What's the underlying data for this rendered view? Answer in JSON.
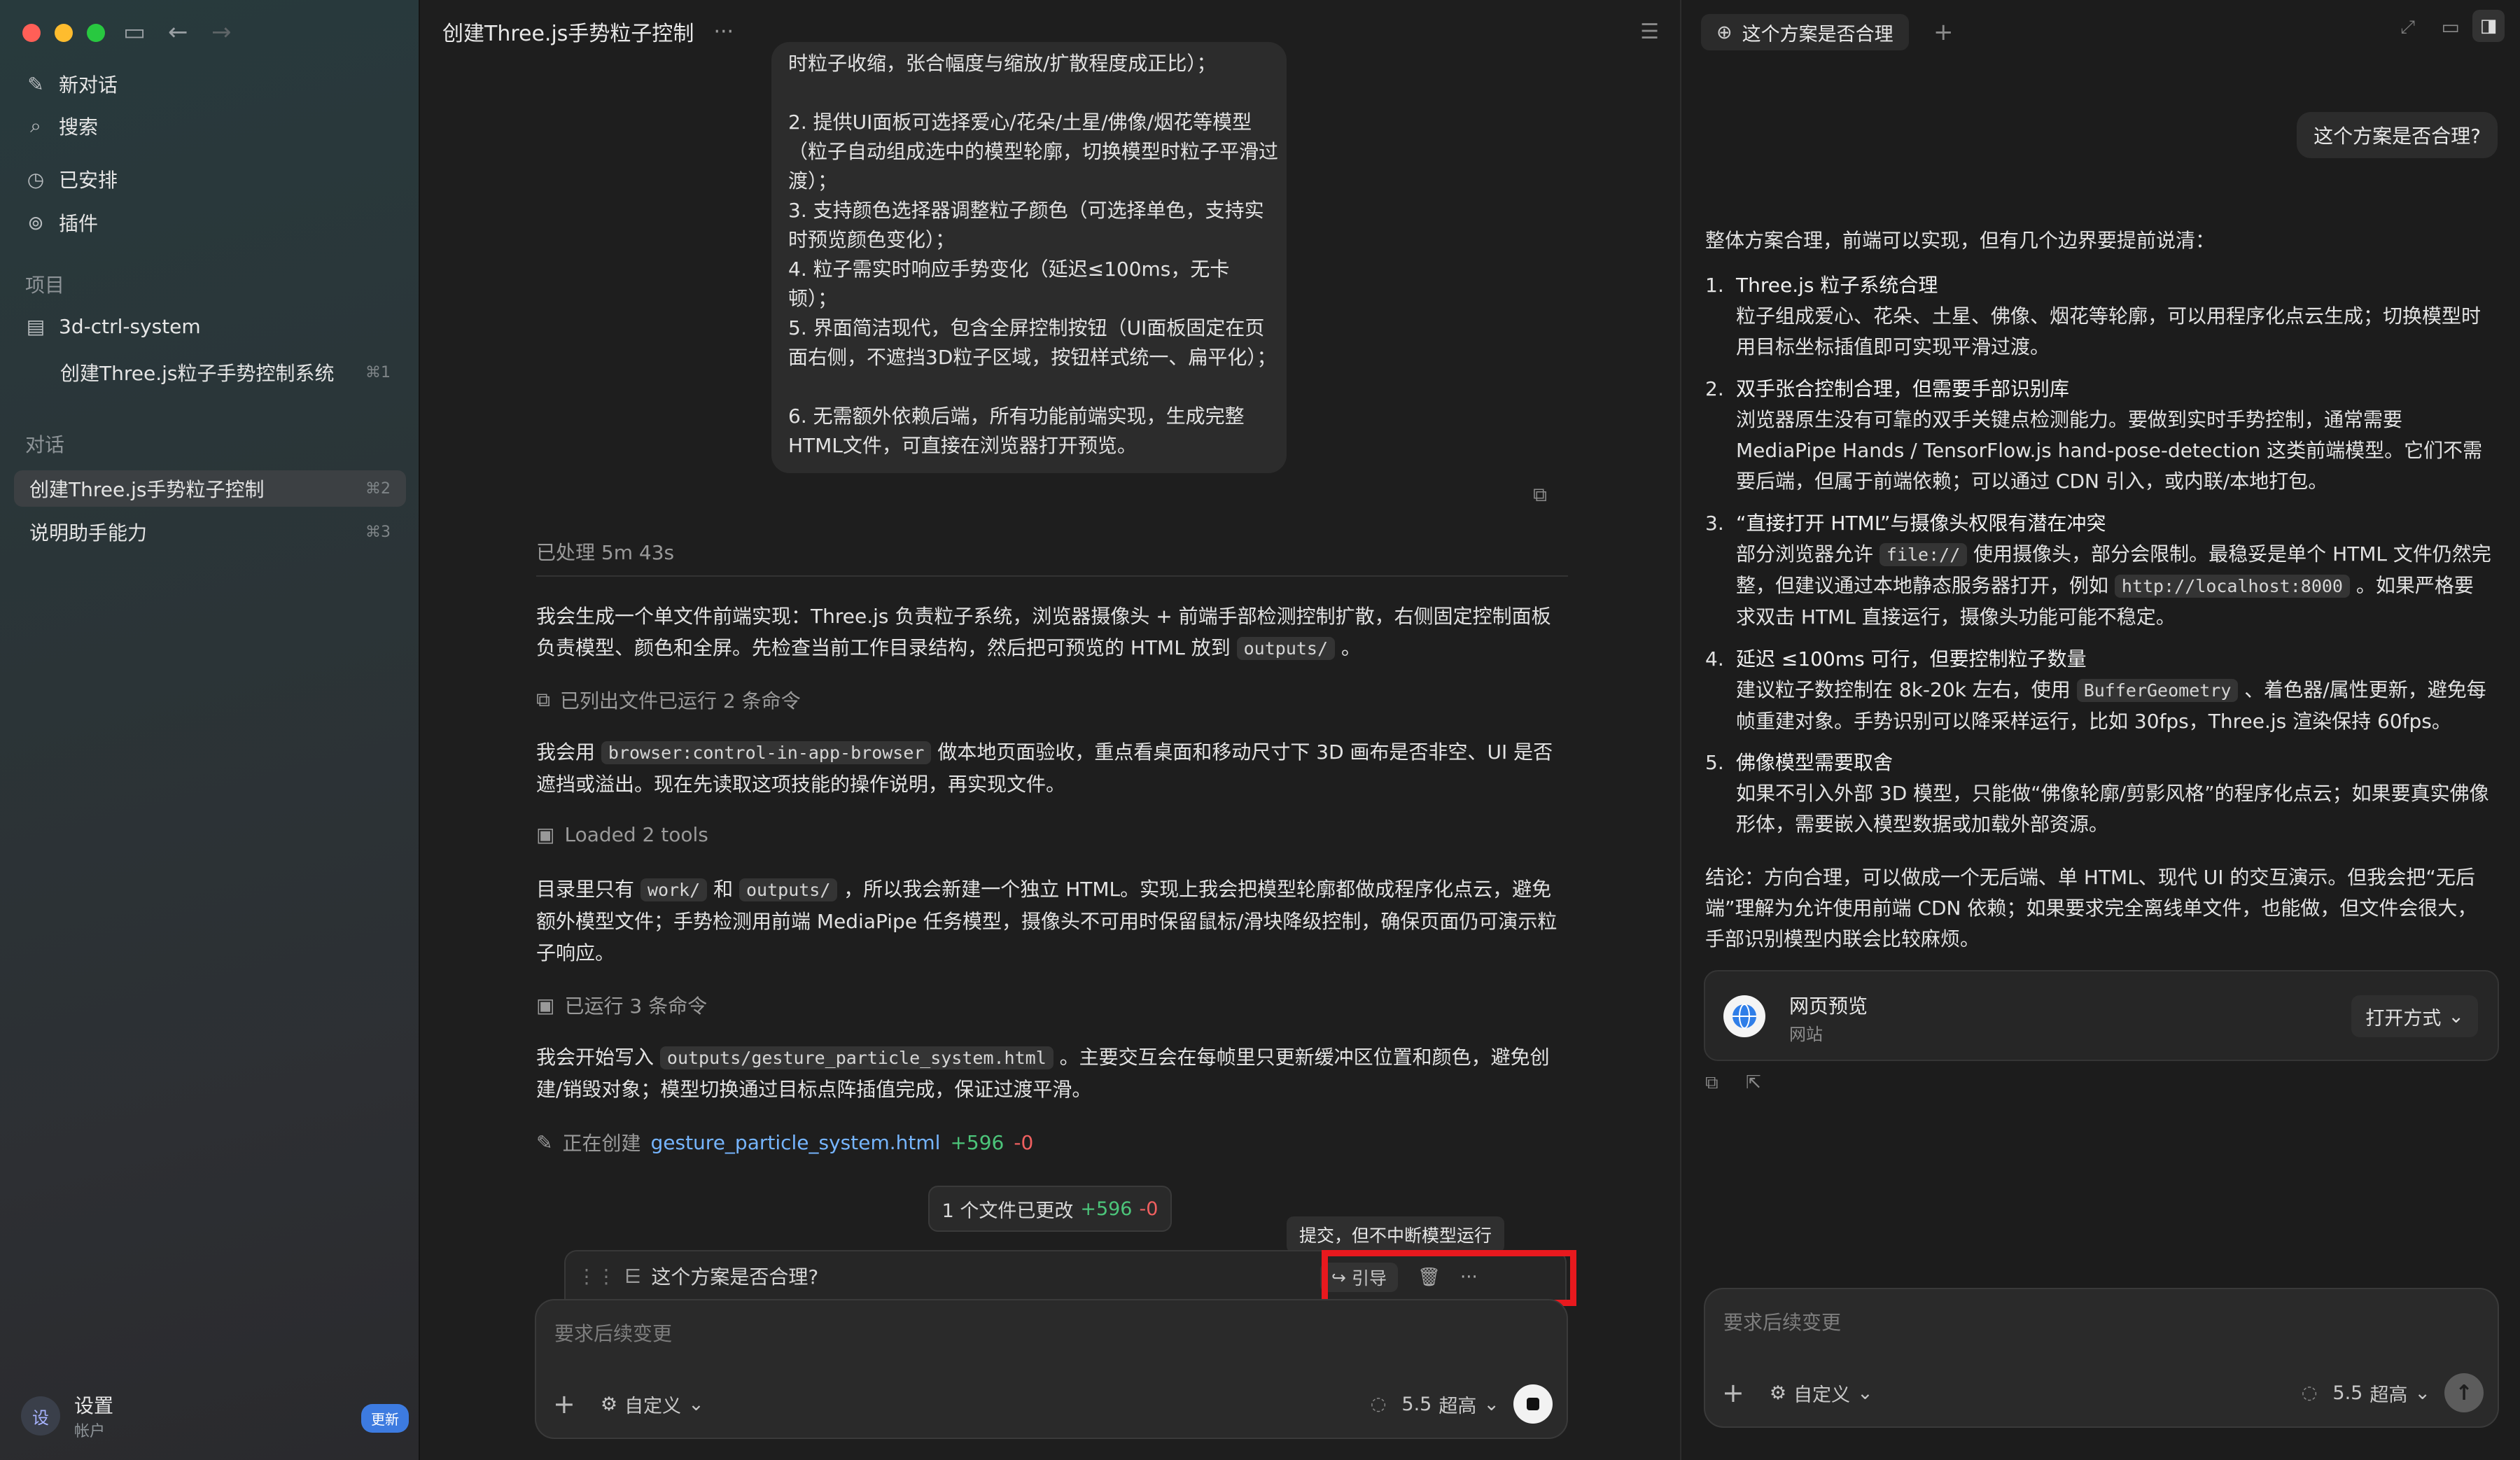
{
  "sidebar": {
    "new_chat": "新对话",
    "search": "搜索",
    "scheduled": "已安排",
    "plugins": "插件",
    "projects_label": "项目",
    "project_name": "3d-ctrl-system",
    "project_chat": "创建Three.js粒子手势控制系统",
    "project_chat_kbd": "⌘1",
    "chats_label": "对话",
    "chats": [
      {
        "label": "创建Three.js手势粒子控制",
        "kbd": "⌘2"
      },
      {
        "label": "说明助手能力",
        "kbd": "⌘3"
      }
    ],
    "user_name": "设置",
    "user_sub": "帐户",
    "avatar": "设",
    "update": "更新"
  },
  "main": {
    "title": "创建Three.js手势粒子控制",
    "bubble": [
      "时粒子收缩，张合幅度与缩放/扩散程度成正比）；",
      "2. 提供UI面板可选择爱心/花朵/土星/佛像/烟花等模型（粒子自动组成选中的模型轮廓，切换模型时粒子平滑过渡）；",
      "3. 支持颜色选择器调整粒子颜色（可选择单色，支持实时预览颜色变化）；",
      "4. 粒子需实时响应手势变化（延迟≤100ms，无卡顿）；",
      "5. 界面简洁现代，包含全屏控制按钮（UI面板固定在页面右侧，不遮挡3D粒子区域，按钮样式统一、扁平化）；",
      "6. 无需额外依赖后端，所有功能前端实现，生成完整HTML文件，可直接在浏览器打开预览。"
    ],
    "processed": "已处理 5m 43s",
    "p1_a": "我会生成一个单文件前端实现：Three.js 负责粒子系统，浏览器摄像头 + 前端手部检测控制扩散，右侧固定控制面板负责模型、颜色和全屏。先检查当前工作目录结构，然后把可预览的 HTML 放到 ",
    "p1_code": "outputs/",
    "p1_b": " 。",
    "s1": "已列出文件已运行 2 条命令",
    "p2_a": "我会用 ",
    "p2_code": "browser:control-in-app-browser",
    "p2_b": " 做本地页面验收，重点看桌面和移动尺寸下 3D 画布是否非空、UI 是否遮挡或溢出。现在先读取这项技能的操作说明，再实现文件。",
    "s2": "Loaded 2 tools",
    "p3_a": "目录里只有 ",
    "p3_code1": "work/",
    "p3_mid": " 和 ",
    "p3_code2": "outputs/",
    "p3_b": " ，所以我会新建一个独立 HTML。实现上我会把模型轮廓都做成程序化点云，避免额外模型文件；手势检测用前端 MediaPipe 任务模型，摄像头不可用时保留鼠标/滑块降级控制，确保页面仍可演示粒子响应。",
    "s3": "已运行 3 条命令",
    "p4_a": "我会开始写入 ",
    "p4_code": "outputs/gesture_particle_system.html",
    "p4_b": " 。主要交互会在每帧里只更新缓冲区位置和颜色，避免创建/销毁对象；模型切换通过目标点阵插值完成，保证过渡平滑。",
    "creating": "正在创建",
    "creating_file": "gesture_particle_system.html",
    "plus": "+596",
    "minus": "-0",
    "files_changed": "1 个文件已更改",
    "tooltip": "提交，但不中断模型运行",
    "queued": "这个方案是否合理?",
    "steer": "引导",
    "composer_placeholder": "要求后续变更",
    "custom": "自定义",
    "model": "5.5",
    "effort": "超高"
  },
  "panel": {
    "tab": "这个方案是否合理",
    "question": "这个方案是否合理?",
    "intro": "整体方案合理，前端可以实现，但有几个边界要提前说清：",
    "items": [
      {
        "n": "1.",
        "title": "Three.js 粒子系统合理",
        "body": "粒子组成爱心、花朵、土星、佛像、烟花等轮廓，可以用程序化点云生成；切换模型时用目标坐标插值即可实现平滑过渡。"
      },
      {
        "n": "2.",
        "title": "双手张合控制合理，但需要手部识别库",
        "body": "浏览器原生没有可靠的双手关键点检测能力。要做到实时手势控制，通常需要 MediaPipe Hands / TensorFlow.js hand-pose-detection 这类前端模型。它们不需要后端，但属于前端依赖；可以通过 CDN 引入，或内联/本地打包。"
      },
      {
        "n": "3.",
        "title": "“直接打开 HTML”与摄像头权限有潜在冲突",
        "body_a": "部分浏览器允许 ",
        "code1": "file://",
        "body_b": " 使用摄像头，部分会限制。最稳妥是单个 HTML 文件仍然完整，但建议通过本地静态服务器打开，例如 ",
        "code2": "http://localhost:8000",
        "body_c": " 。如果严格要求双击 HTML 直接运行，摄像头功能可能不稳定。"
      },
      {
        "n": "4.",
        "title": "延迟 ≤100ms 可行，但要控制粒子数量",
        "body_a": "建议粒子数控制在 8k-20k 左右，使用 ",
        "code1": "BufferGeometry",
        "body_b": " 、着色器/属性更新，避免每帧重建对象。手势识别可以降采样运行，比如 30fps，Three.js 渲染保持 60fps。"
      },
      {
        "n": "5.",
        "title": "佛像模型需要取舍",
        "body": "如果不引入外部 3D 模型，只能做“佛像轮廓/剪影风格”的程序化点云；如果要真实佛像形体，需要嵌入模型数据或加载外部资源。"
      }
    ],
    "conclusion": "结论：方向合理，可以做成一个无后端、单 HTML、现代 UI 的交互演示。但我会把“无后端”理解为允许使用前端 CDN 依赖；如果要求完全离线单文件，也能做，但文件会很大，手部识别模型内联会比较麻烦。",
    "preview_title": "网页预览",
    "preview_sub": "网站",
    "open_with": "打开方式",
    "composer_placeholder": "要求后续变更",
    "custom": "自定义",
    "model": "5.5",
    "effort": "超高"
  },
  "colors": {
    "accent": "#3d7be0",
    "added": "#4cc57a",
    "removed": "#f06060",
    "highlight": "#e8191e"
  }
}
